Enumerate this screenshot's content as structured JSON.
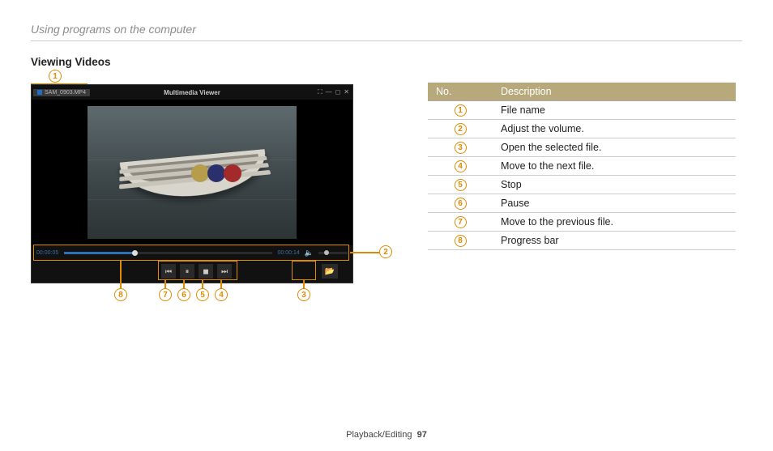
{
  "chapter_title": "Using programs on the computer",
  "section_title": "Viewing Videos",
  "footer": {
    "section": "Playback/Editing",
    "page": "97"
  },
  "player": {
    "window_title": "Multimedia Viewer",
    "file_name": "SAM_0903.MP4",
    "time_elapsed": "00:00:05",
    "time_total": "00:00:14",
    "window_controls": {
      "fullscreen": "⛶",
      "minimize": "—",
      "maximize": "◻",
      "close": "✕"
    },
    "buttons": {
      "prev": "⏮",
      "pause": "⏸",
      "stop": "◼",
      "next": "⏭",
      "open": "📂"
    },
    "volume_icon": "🔈"
  },
  "legend": {
    "header_no": "No.",
    "header_desc": "Description",
    "rows": [
      {
        "n": "1",
        "desc": "File name"
      },
      {
        "n": "2",
        "desc": "Adjust the volume."
      },
      {
        "n": "3",
        "desc": "Open the selected file."
      },
      {
        "n": "4",
        "desc": "Move to the next file."
      },
      {
        "n": "5",
        "desc": "Stop"
      },
      {
        "n": "6",
        "desc": "Pause"
      },
      {
        "n": "7",
        "desc": "Move to the previous file."
      },
      {
        "n": "8",
        "desc": "Progress bar"
      }
    ]
  },
  "callouts": {
    "c1": "1",
    "c2": "2",
    "c3": "3",
    "c4": "4",
    "c5": "5",
    "c6": "6",
    "c7": "7",
    "c8": "8"
  }
}
